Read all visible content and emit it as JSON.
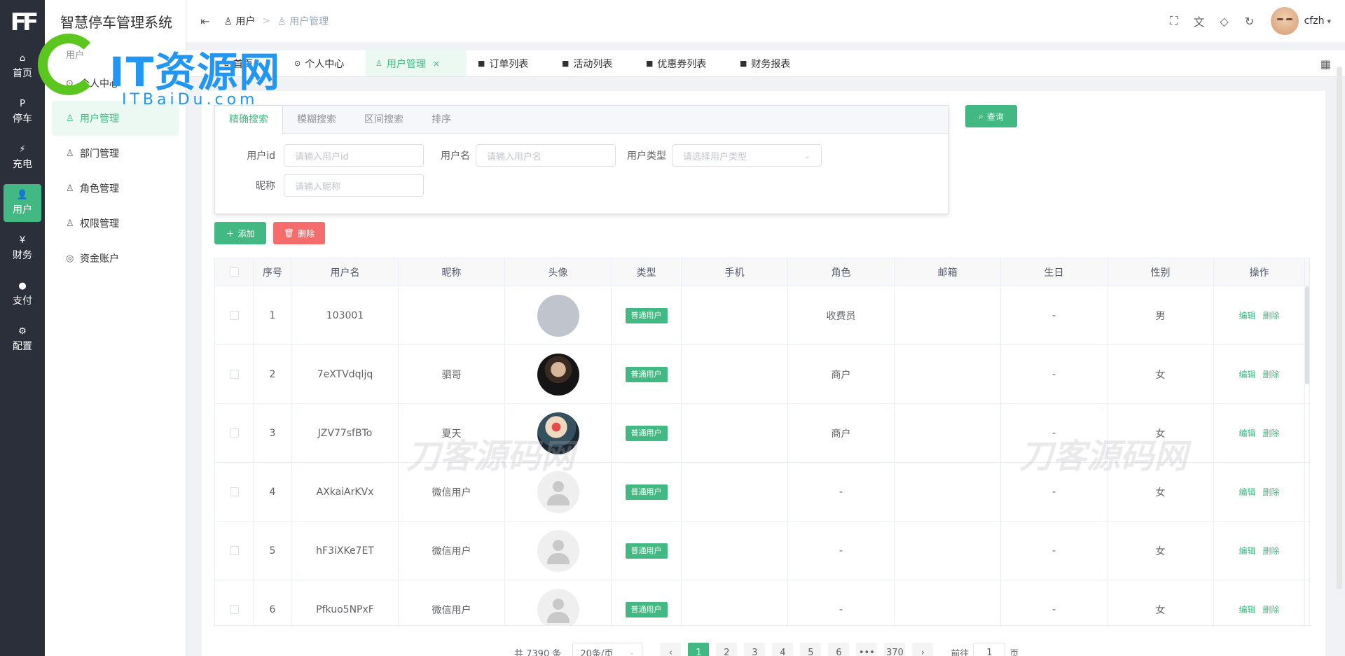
{
  "app": {
    "logo_mark": "FF",
    "system_title": "智慧停车管理系统"
  },
  "rail": [
    {
      "icon": "⌂",
      "label": "首页"
    },
    {
      "icon": "P",
      "label": "停车"
    },
    {
      "icon": "⚡",
      "label": "充电"
    },
    {
      "icon": "👤",
      "label": "用户"
    },
    {
      "icon": "¥",
      "label": "财务"
    },
    {
      "icon": "●",
      "label": "支付"
    },
    {
      "icon": "⚙",
      "label": "配置"
    }
  ],
  "submenu": {
    "group_label": "用户",
    "items": [
      {
        "icon": "⊙",
        "label": "个人中心"
      },
      {
        "icon": "♙",
        "label": "用户管理"
      },
      {
        "icon": "♙",
        "label": "部门管理"
      },
      {
        "icon": "♙",
        "label": "角色管理"
      },
      {
        "icon": "♙",
        "label": "权限管理"
      },
      {
        "icon": "◎",
        "label": "资金账户"
      }
    ]
  },
  "breadcrumb": {
    "level1": "用户",
    "separator": ">",
    "level2": "用户管理"
  },
  "header": {
    "username": "cfzh"
  },
  "tabs": [
    {
      "label": "首页"
    },
    {
      "label": "个人中心"
    },
    {
      "label": "用户管理",
      "close": "×"
    },
    {
      "label": "订单列表"
    },
    {
      "label": "活动列表"
    },
    {
      "label": "优惠券列表"
    },
    {
      "label": "财务报表"
    }
  ],
  "search": {
    "tabs": [
      "精确搜索",
      "模糊搜索",
      "区间搜索",
      "排序"
    ],
    "fields": {
      "user_id": {
        "label": "用户id",
        "placeholder": "请输入用户id"
      },
      "username": {
        "label": "用户名",
        "placeholder": "请输入用户名"
      },
      "user_type": {
        "label": "用户类型",
        "placeholder": "请选择用户类型"
      },
      "nickname": {
        "label": "昵称",
        "placeholder": "请输入昵称"
      }
    },
    "query_label": "查询"
  },
  "actions": {
    "add_label": "添加",
    "delete_label": "删除"
  },
  "table": {
    "columns": [
      "序号",
      "用户名",
      "昵称",
      "头像",
      "类型",
      "手机",
      "角色",
      "邮箱",
      "生日",
      "性别",
      "操作"
    ],
    "rows": [
      {
        "no": "1",
        "username": "103001",
        "nickname": "",
        "avatar": "blank",
        "type": "普通用户",
        "phone": "",
        "role": "收费员",
        "email": "",
        "birthday": "-",
        "gender": "男"
      },
      {
        "no": "2",
        "username": "7eXTVdqljq",
        "nickname": "驷哥",
        "avatar": "photo1",
        "type": "普通用户",
        "phone": "",
        "role": "商户",
        "email": "",
        "birthday": "-",
        "gender": "女"
      },
      {
        "no": "3",
        "username": "JZV77sfBTo",
        "nickname": "夏天",
        "avatar": "photo2",
        "type": "普通用户",
        "phone": "",
        "role": "商户",
        "email": "",
        "birthday": "-",
        "gender": "女"
      },
      {
        "no": "4",
        "username": "AXkaiArKVx",
        "nickname": "微信用户",
        "avatar": "default",
        "type": "普通用户",
        "phone": "",
        "role": "-",
        "email": "",
        "birthday": "-",
        "gender": "女"
      },
      {
        "no": "5",
        "username": "hF3iXKe7ET",
        "nickname": "微信用户",
        "avatar": "default",
        "type": "普通用户",
        "phone": "",
        "role": "-",
        "email": "",
        "birthday": "-",
        "gender": "女"
      },
      {
        "no": "6",
        "username": "Pfkuo5NPxF",
        "nickname": "微信用户",
        "avatar": "default",
        "type": "普通用户",
        "phone": "",
        "role": "-",
        "email": "",
        "birthday": "-",
        "gender": "女"
      }
    ],
    "row_edit": "编辑",
    "row_delete": "删除"
  },
  "pagination": {
    "total": "共 7390 条",
    "page_size": "20条/页",
    "pages": [
      "1",
      "2",
      "3",
      "4",
      "5",
      "6",
      "•••",
      "370"
    ],
    "current": "1",
    "goto_prefix": "前往",
    "goto_value": "1",
    "goto_suffix": "页"
  },
  "watermarks": {
    "logo_text": "IT资源网",
    "logo_sub": "ITBaiDu.com",
    "center_text": "刀客源码网"
  },
  "colors": {
    "accent": "#42b983",
    "danger": "#f56c6c",
    "rail_bg": "#2b2f3a"
  }
}
